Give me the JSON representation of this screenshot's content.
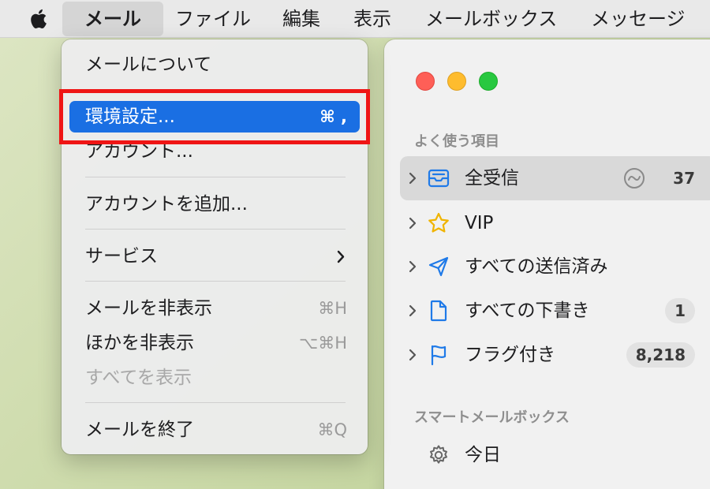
{
  "menubar": {
    "apple_icon": "apple-logo-icon",
    "items": [
      {
        "label": "メール",
        "active": true
      },
      {
        "label": "ファイル"
      },
      {
        "label": "編集"
      },
      {
        "label": "表示"
      },
      {
        "label": "メールボックス"
      },
      {
        "label": "メッセージ"
      }
    ]
  },
  "menu": {
    "items": [
      {
        "label": "メールについて"
      },
      {
        "label": "環境設定...",
        "shortcut": "⌘ ,",
        "highlighted": true
      },
      {
        "label": "アカウント..."
      },
      {
        "label": "アカウントを追加..."
      },
      {
        "label": "サービス",
        "submenu": true
      },
      {
        "label": "メールを非表示",
        "shortcut": "⌘H"
      },
      {
        "label": "ほかを非表示",
        "shortcut": "⌥⌘H"
      },
      {
        "label": "すべてを表示",
        "disabled": true
      },
      {
        "label": "メールを終了",
        "shortcut": "⌘Q"
      }
    ]
  },
  "sidebar": {
    "favorites_title": "よく使う項目",
    "favorites": [
      {
        "label": "全受信",
        "icon": "inbox-tray-icon",
        "count": "37",
        "selected": true
      },
      {
        "label": "VIP",
        "icon": "star-icon"
      },
      {
        "label": "すべての送信済み",
        "icon": "paper-plane-icon"
      },
      {
        "label": "すべての下書き",
        "icon": "document-icon",
        "badge": "1"
      },
      {
        "label": "フラグ付き",
        "icon": "flag-icon",
        "badge": "8,218"
      }
    ],
    "smart_title": "スマートメールボックス",
    "smart": [
      {
        "label": "今日",
        "icon": "gear-icon"
      }
    ]
  },
  "colors": {
    "accent": "#1a6fe3",
    "highlight_box": "#ef1515",
    "sidebar_icon": "#1f7ae8",
    "vip_star": "#f0b400"
  }
}
